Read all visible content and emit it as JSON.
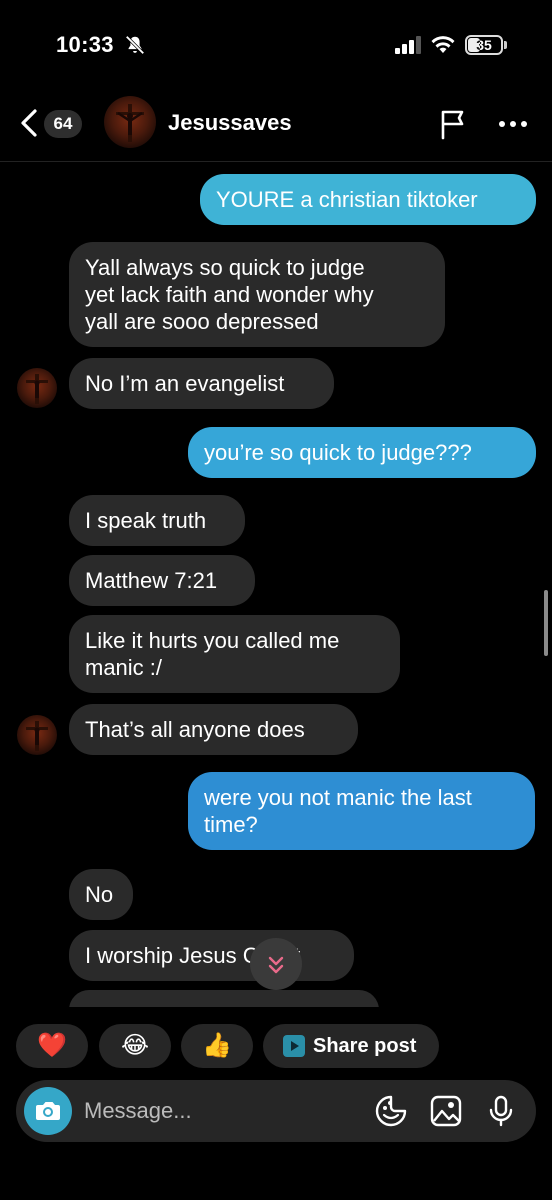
{
  "status": {
    "time": "10:33",
    "battery": "35"
  },
  "header": {
    "unread_count": "64",
    "name": "Jesussaves"
  },
  "colors": {
    "sent_bubble_light": "#3fb3d6",
    "sent_bubble_dark": "#2e8ed3",
    "received_bubble": "#2a2a2a",
    "camera_button": "#35a7c8"
  },
  "messages": [
    {
      "from": "me",
      "text": "YOURE a christian tiktoker"
    },
    {
      "from": "them",
      "text": "Yall always so quick to judge\nyet lack faith  and wonder why\nyall are sooo depressed"
    },
    {
      "from": "them",
      "text": "No I’m an evangelist"
    },
    {
      "from": "me",
      "text": "you’re so quick to judge???"
    },
    {
      "from": "them",
      "text": "I speak truth"
    },
    {
      "from": "them",
      "text": "Matthew 7:21"
    },
    {
      "from": "them",
      "text": "Like it hurts you called me\nmanic :/"
    },
    {
      "from": "them",
      "text": "That’s all anyone does"
    },
    {
      "from": "me",
      "text": "were you not manic the last\ntime?"
    },
    {
      "from": "them",
      "text": "No"
    },
    {
      "from": "them",
      "text": "I worship Jesus Christ"
    }
  ],
  "reactions": {
    "heart": "❤️",
    "laugh": "😂",
    "thumbs": "👍",
    "share_label": "Share post"
  },
  "composer": {
    "placeholder": "Message..."
  },
  "icons": [
    "chevron-left-icon",
    "flag-icon",
    "more-icon",
    "camera-icon",
    "sticker-icon",
    "image-icon",
    "microphone-icon",
    "chevron-double-down-icon"
  ]
}
